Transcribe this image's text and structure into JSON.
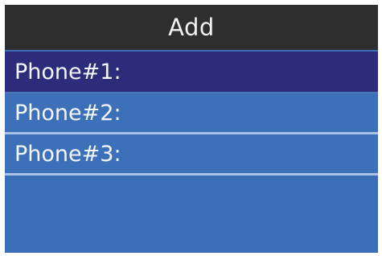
{
  "header": {
    "title": "Add"
  },
  "list": {
    "items": [
      {
        "label": "Phone#1:"
      },
      {
        "label": "Phone#2:"
      },
      {
        "label": "Phone#3:"
      }
    ],
    "selected_index": 0
  },
  "colors": {
    "header_bg": "#2e2e2e",
    "screen_bg": "#3a6fb8",
    "selected_row_bg": "#2c2c7a",
    "divider": "#a9c3e6",
    "text": "#f4f6fa"
  }
}
